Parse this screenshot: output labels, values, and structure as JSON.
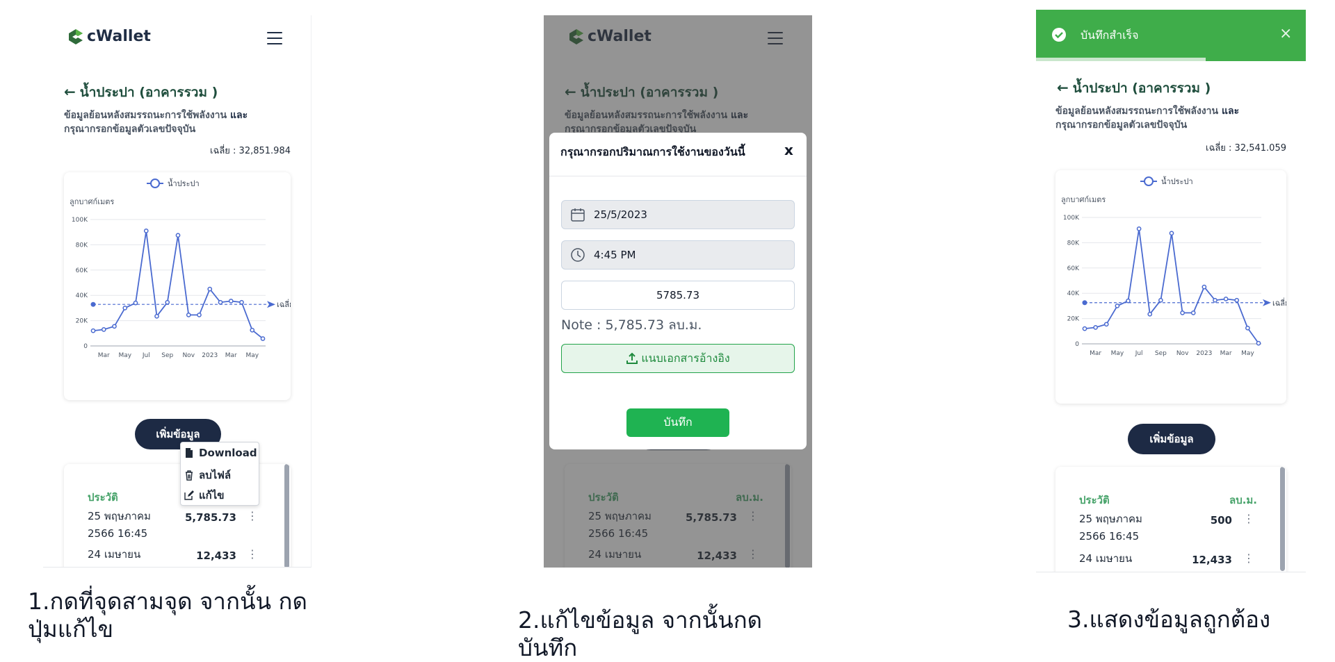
{
  "app": {
    "logo_text": "cWallet"
  },
  "page_title": "น้ำประปา (อาคารรวม )",
  "subtitle_a": "ข้อมูลย้อนหลังสมรรถนะการใช้พลังงาน",
  "subtitle_and": "และ",
  "subtitle_b": "กรุณากรอกข้อมูลตัวเลขปัจจุบัน",
  "panel1": {
    "average": "เฉลี่ย : 32,851.984",
    "caption_line1": "1.กดที่จุดสามจุด จากนั้น กด",
    "caption_line2": "ปุ่มแก้ไข"
  },
  "panel2": {
    "caption_line1": "2.แก้ไขข้อมูล จากนั้นกด",
    "caption_line2": "บันทึก"
  },
  "panel3": {
    "average": "เฉลี่ย : 32,541.059",
    "caption": "3.แสดงข้อมูลถูกต้อง"
  },
  "add_button": "เพิ่มข้อมูล",
  "context_menu": {
    "download": "Download",
    "delete": "ลบไฟล์",
    "edit": "แก้ไข"
  },
  "history": {
    "header_left": "ประวัติ",
    "header_right": "ลบ.ม.",
    "rows": [
      {
        "date_line1": "25 พฤษภาคม",
        "date_line2": "2566 16:45",
        "value": "5,785.73"
      },
      {
        "date_line1": "24 เมษายน",
        "value": "12,433"
      }
    ],
    "row1_value_after": "500"
  },
  "modal": {
    "title": "กรุณากรอกปริมาณการใช้งานของวันนี้",
    "close": "x",
    "date": "25/5/2023",
    "time": "4:45 PM",
    "amount": "5785.73",
    "note": "Note : 5,785.73 ลบ.ม.",
    "upload": "แนบเอกสารอ้างอิง",
    "save": "บันทึก"
  },
  "toast": {
    "message": "บันทึกสำเร็จ",
    "close": "×"
  },
  "chart_data": {
    "type": "line",
    "legend": "น้ำประปา",
    "ylabel": "ลูกบาศก์เมตร",
    "ylim": [
      0,
      100000
    ],
    "yticks": [
      "0",
      "20K",
      "40K",
      "60K",
      "80K",
      "100K"
    ],
    "xticks": [
      "Mar",
      "May",
      "Jul",
      "Sep",
      "Nov",
      "2023",
      "Mar",
      "May"
    ],
    "avg_label": "เฉลี่ย",
    "series": [
      {
        "values": [
          12000,
          13000,
          15500,
          30000,
          34000,
          91000,
          23500,
          34500,
          87500,
          24500,
          24500,
          45000,
          34500,
          35500,
          34500,
          12500,
          5785.73
        ]
      },
      {
        "values": [
          12000,
          13000,
          15500,
          30000,
          34000,
          91000,
          23500,
          34500,
          87500,
          24500,
          24500,
          45000,
          34500,
          35500,
          34500,
          12500,
          500
        ]
      }
    ],
    "averages": [
      32851.984,
      32541.059
    ],
    "colors": {
      "line": "#4a6ad0",
      "avg": "#4a6ad0"
    }
  },
  "colors": {
    "brand": "#1f2d44",
    "green": "#1fb352",
    "toast": "#3fad4a",
    "title": "#1f4e3d"
  },
  "icons": [
    "logo-icon",
    "hamburger-icon",
    "arrow-left-icon",
    "file-icon",
    "trash-icon",
    "edit-icon",
    "calendar-icon",
    "clock-icon",
    "upload-icon",
    "check-circle-icon",
    "close-icon",
    "more-vertical-icon"
  ]
}
